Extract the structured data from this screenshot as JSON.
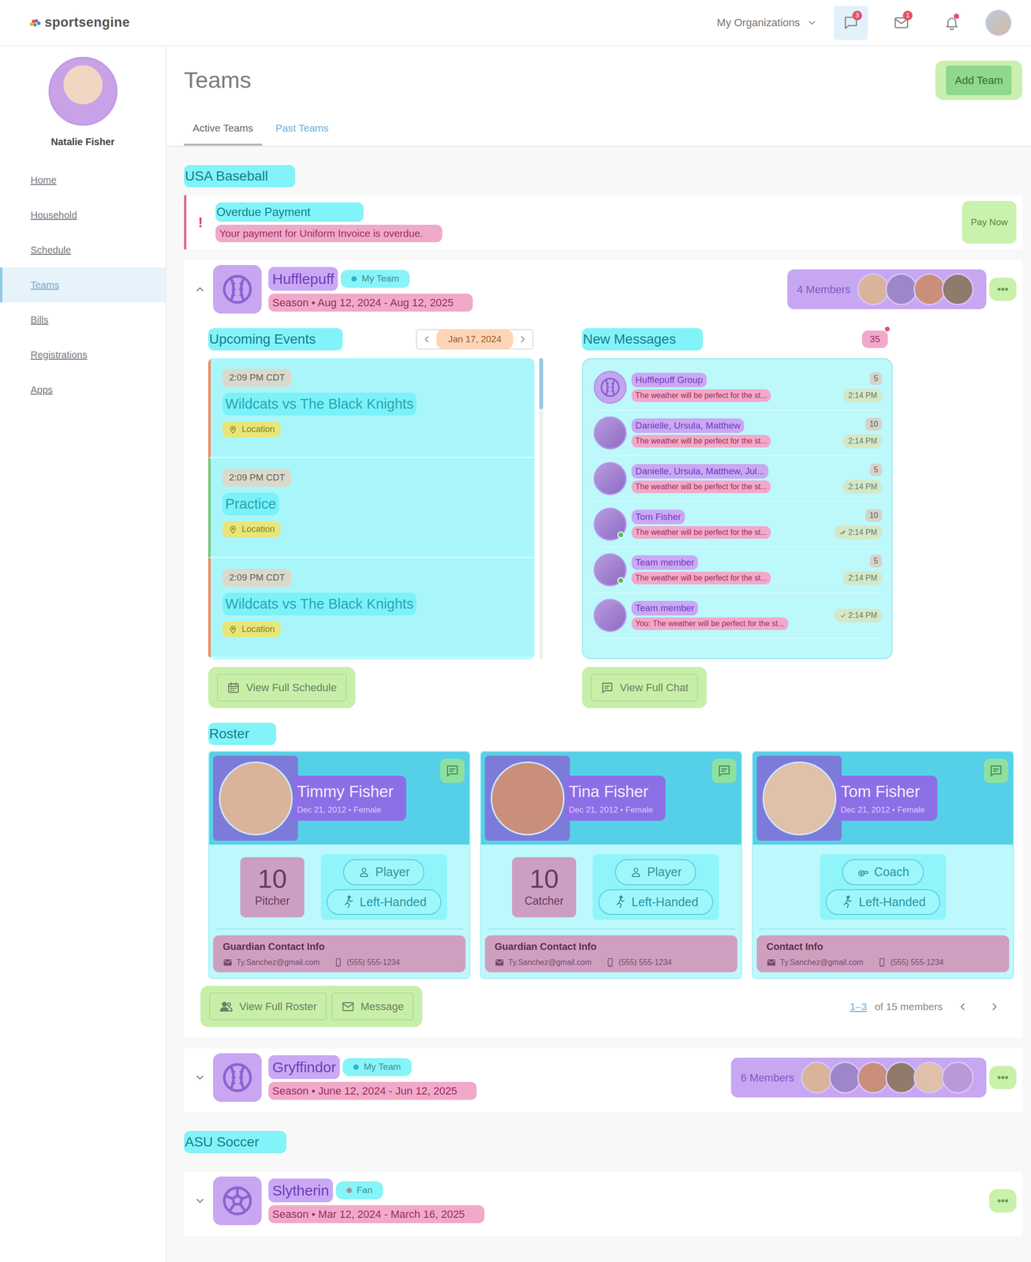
{
  "header": {
    "logo": "sportsengine",
    "org_menu": "My Organizations",
    "chat_badge": "3",
    "mail_badge": "1",
    "bell_dot": true
  },
  "user": {
    "name": "Natalie Fisher"
  },
  "sidebar": {
    "items": [
      {
        "label": "Home",
        "selected": false
      },
      {
        "label": "Household",
        "selected": false
      },
      {
        "label": "Schedule",
        "selected": false
      },
      {
        "label": "Teams",
        "selected": true
      },
      {
        "label": "Bills",
        "selected": false
      },
      {
        "label": "Registrations",
        "selected": false
      },
      {
        "label": "Apps",
        "selected": false
      }
    ]
  },
  "page": {
    "title": "Teams",
    "add_button": "Add Team",
    "tabs": [
      {
        "label": "Active Teams",
        "selected": true
      },
      {
        "label": "Past Teams",
        "selected": false
      }
    ]
  },
  "groups": [
    {
      "name": "USA Baseball",
      "alert": {
        "icon": "!",
        "title": "Overdue Payment",
        "text": "Your payment for Uniform Invoice is overdue.",
        "button": "Pay Now"
      },
      "teams": [
        {
          "name": "Hufflepuff",
          "kind": "baseball",
          "tag": "My Team",
          "tag_color": "#2bb5c9",
          "season": "Season • Aug 12, 2024 - Aug 12, 2025",
          "expanded": true,
          "members_label": "4 Members",
          "avatar_count": 4,
          "events": {
            "title": "Upcoming Events",
            "date": "Jan 17, 2024",
            "items": [
              {
                "time": "2:09 PM CDT",
                "title": "Wildcats vs The Black Knights",
                "location": "Location",
                "color": "#f08a5d"
              },
              {
                "time": "2:09 PM CDT",
                "title": "Practice",
                "location": "Location",
                "color": "#7cc47c"
              },
              {
                "time": "2:09 PM CDT",
                "title": "Wildcats vs The Black Knights",
                "location": "Location",
                "color": "#f08a5d"
              }
            ]
          },
          "messages": {
            "title": "New Messages",
            "count": "35",
            "items": [
              {
                "name": "Hufflepuff Group",
                "kind": "group",
                "preview": "The weather will be perfect for the st...",
                "count": "5",
                "time": "2:14 PM",
                "check": "none",
                "online": false
              },
              {
                "name": "Danielle, Ursula, Matthew",
                "kind": "photo",
                "preview": "The weather will be perfect for the st...",
                "count": "10",
                "time": "2:14 PM",
                "check": "none",
                "online": false
              },
              {
                "name": "Danielle, Ursula, Matthew, Jul...",
                "kind": "photo",
                "preview": "The weather will be perfect for the st...",
                "count": "5",
                "time": "2:14 PM",
                "check": "none",
                "online": false
              },
              {
                "name": "Tom Fisher",
                "kind": "photo",
                "preview": "The weather will be perfect for the st...",
                "count": "10",
                "time": "2:14 PM",
                "check": "double",
                "online": true
              },
              {
                "name": "Team member",
                "kind": "photo",
                "preview": "The weather will be perfect for the st...",
                "count": "5",
                "time": "2:14 PM",
                "check": "none",
                "online": true
              },
              {
                "name": "Team member",
                "kind": "photo",
                "preview": "You: The weather will be perfect for the st...",
                "time": "2:14 PM",
                "check": "single",
                "online": false
              }
            ]
          },
          "schedule_button": "View Full Schedule",
          "chat_button": "View Full Chat",
          "roster": {
            "title": "Roster",
            "members": [
              {
                "name": "Timmy Fisher",
                "info": "Dec 21, 2012 • Female",
                "number": "10",
                "position": "Pitcher",
                "role": "Player",
                "role_kind": "player",
                "hand": "Left-Handed",
                "contact_label": "Guardian Contact Info",
                "email": "Ty.Sanchez@gmail.com",
                "phone": "(555) 555-1234"
              },
              {
                "name": "Tina Fisher",
                "info": "Dec 21, 2012 • Female",
                "number": "10",
                "position": "Catcher",
                "role": "Player",
                "role_kind": "player",
                "hand": "Left-Handed",
                "contact_label": "Guardian Contact Info",
                "email": "Ty.Sanchez@gmail.com",
                "phone": "(555) 555-1234"
              },
              {
                "name": "Tom Fisher",
                "info": "Dec 21, 2012 • Female",
                "role": "Coach",
                "role_kind": "coach",
                "hand": "Left-Handed",
                "contact_label": "Contact Info",
                "email": "Ty.Sanchez@gmail.com",
                "phone": "(555) 555-1234"
              }
            ],
            "roster_button": "View Full Roster",
            "message_button": "Message",
            "pager_range": "1–3",
            "pager_text": "of 15 members"
          }
        },
        {
          "name": "Gryffindor",
          "kind": "baseball",
          "tag": "My Team",
          "tag_color": "#2bb5c9",
          "season": "Season • June 12, 2024 - Jun 12, 2025",
          "expanded": false,
          "members_label": "6 Members",
          "avatar_count": 6
        }
      ]
    },
    {
      "name": "ASU Soccer",
      "teams": [
        {
          "name": "Slytherin",
          "kind": "soccer",
          "tag": "Fan",
          "tag_color": "#9a9a9a",
          "season": "Season • Mar 12, 2024 - March 16, 2025",
          "expanded": false,
          "avatar_count": 0
        }
      ]
    }
  ]
}
